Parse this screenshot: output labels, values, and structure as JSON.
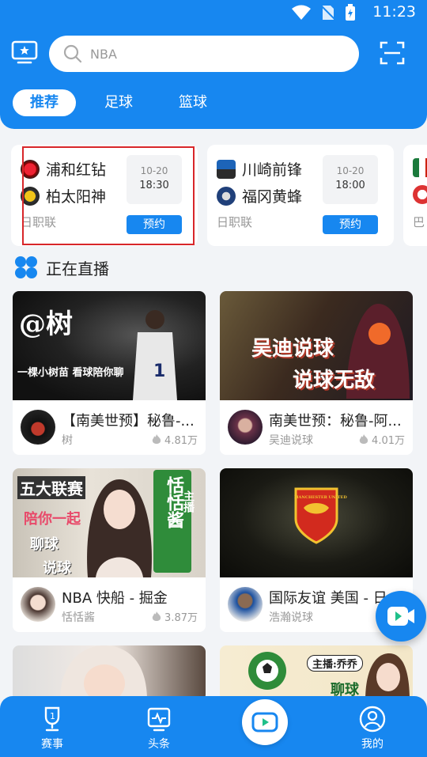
{
  "status": {
    "time": "11:23"
  },
  "search": {
    "placeholder": "NBA"
  },
  "tabs": [
    {
      "label": "推荐",
      "active": true
    },
    {
      "label": "足球",
      "active": false
    },
    {
      "label": "篮球",
      "active": false
    }
  ],
  "matches": [
    {
      "home": "浦和红钻",
      "away": "柏太阳神",
      "date": "10-20",
      "time": "18:30",
      "league": "日职联",
      "action": "预约"
    },
    {
      "home": "川崎前锋",
      "away": "福冈黄蜂",
      "date": "10-20",
      "time": "18:00",
      "league": "日职联",
      "action": "预约"
    },
    {
      "league": "巴"
    }
  ],
  "live_section": {
    "title": "正在直播"
  },
  "live_cards": [
    {
      "title": "【南美世预】秘鲁-...",
      "host": "树",
      "views": "4.81万",
      "thumb_text": [
        "@树",
        "一棵小树苗 看球陪你聊"
      ]
    },
    {
      "title": "南美世预：秘鲁-阿...",
      "host": "吴迪说球",
      "views": "4.01万",
      "thumb_text": [
        "吴迪说球",
        "说球无敌"
      ]
    },
    {
      "title": "NBA 快船 - 掘金",
      "host": "恬恬酱",
      "views": "3.87万",
      "thumb_text": [
        "五大联赛",
        "陪你一起",
        "聊球",
        "说球",
        "恬恬酱",
        "主播"
      ]
    },
    {
      "title": "国际友谊 美国 - 日...",
      "host": "浩瀚说球",
      "views": "",
      "thumb_text": [
        "MANCHESTER UNITED"
      ]
    },
    {
      "title": "",
      "host": "",
      "views": "",
      "thumb_text": []
    },
    {
      "title": "",
      "host": "",
      "views": "",
      "thumb_text": [
        "主播:乔乔",
        "聊球"
      ]
    }
  ],
  "bottom_nav": [
    {
      "label": "赛事"
    },
    {
      "label": "头条"
    },
    {
      "label": "我的"
    }
  ],
  "colors": {
    "primary": "#1787f0",
    "highlight": "#d8262a"
  }
}
